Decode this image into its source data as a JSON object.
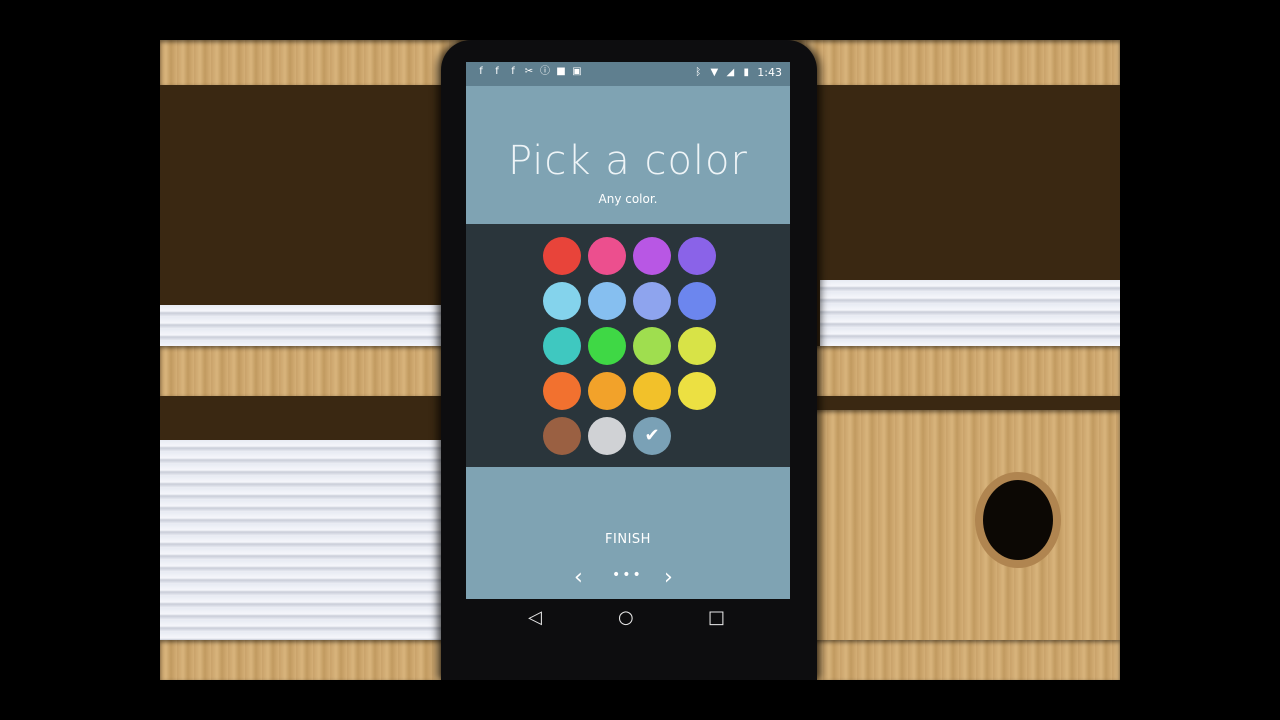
{
  "status_bar": {
    "time": "1:43"
  },
  "header": {
    "title": "Pick a color",
    "subtitle": "Any color."
  },
  "swatches": [
    {
      "color": "#e8443a",
      "selected": false
    },
    {
      "color": "#ec4f8e",
      "selected": false
    },
    {
      "color": "#b857e4",
      "selected": false
    },
    {
      "color": "#8a63e8",
      "selected": false
    },
    {
      "color": "#84d3ec",
      "selected": false
    },
    {
      "color": "#86bff0",
      "selected": false
    },
    {
      "color": "#8ea4ee",
      "selected": false
    },
    {
      "color": "#6c86ee",
      "selected": false
    },
    {
      "color": "#3fc8c0",
      "selected": false
    },
    {
      "color": "#3fd845",
      "selected": false
    },
    {
      "color": "#9fde4f",
      "selected": false
    },
    {
      "color": "#d8e347",
      "selected": false
    },
    {
      "color": "#f2712f",
      "selected": false
    },
    {
      "color": "#f2a22a",
      "selected": false
    },
    {
      "color": "#f2c12a",
      "selected": false
    },
    {
      "color": "#ece042",
      "selected": false
    },
    {
      "color": "#9a6042",
      "selected": false
    },
    {
      "color": "#d0d2d5",
      "selected": false
    },
    {
      "color": "#7aa1b6",
      "selected": true
    }
  ],
  "footer": {
    "finish_label": "FINISH",
    "prev_icon": "‹",
    "next_icon": "›",
    "dots": "•••"
  },
  "nav": {
    "back": "◁",
    "home": "○",
    "recents": "□"
  }
}
